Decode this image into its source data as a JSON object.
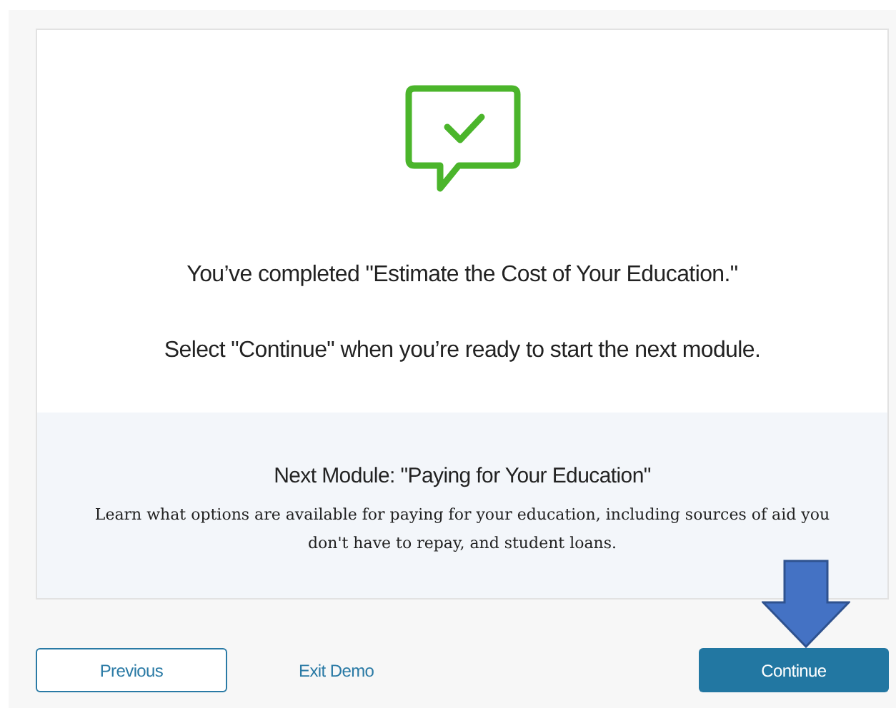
{
  "completion": {
    "message": "You’ve completed \"Estimate the Cost of Your Education.\"",
    "instruction": "Select \"Continue\" when you’re ready to start the next module."
  },
  "next_module": {
    "title": "Next Module: \"Paying for Your Education\"",
    "description": "Learn what options are available for paying for your education, including sources of aid you don't have to repay, and student loans."
  },
  "buttons": [
    {
      "kind": "outline",
      "label": "Previous"
    },
    {
      "kind": "link",
      "label": "Exit Demo"
    },
    {
      "kind": "primary",
      "label": "Continue"
    }
  ]
}
